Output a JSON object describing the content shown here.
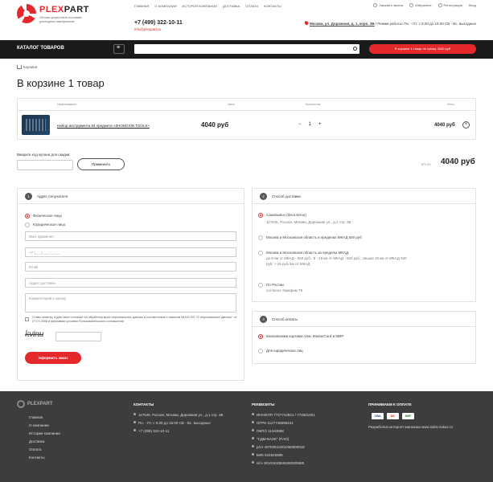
{
  "header": {
    "logo_name_a": "PLEX",
    "logo_name_b": "PART",
    "logo_sub": "Оптово-розничные поставки расходных материалов",
    "nav": [
      "Главная",
      "О компании",
      "История компании",
      "Доставка",
      "Оплата",
      "Контакты"
    ],
    "links": [
      "Заказать звонок",
      "Избранное",
      "Регистрация",
      "Вход"
    ],
    "phone": "+7 (499) 322-10-11",
    "email": "info@plexpart.ru",
    "address": "Москва, ул. Дорожная, д. 1, корп. 3Б",
    "hours": " / Режим работы: Пн. - Пт. с 9.00 до 18.00 СБ - Вс. выходные"
  },
  "bar": {
    "catalog": "Каталог товаров",
    "cart_button": "В корзине 1 товар на сумму 4040 руб"
  },
  "breadcrumb": "Корзина",
  "title": "В корзине 1 товар",
  "cart": {
    "headers": [
      "Наименование",
      "Цена",
      "Количество",
      "Итого"
    ],
    "item": {
      "name": "Набор инструмента 94 предмета «ZHONGXIN TOOLS»",
      "price": "4040 руб",
      "minus": "−",
      "qty": "1",
      "plus": "+",
      "total": "4040 руб",
      "remove": "×"
    }
  },
  "coupon": {
    "label": "Введите код купона для скидки:",
    "button": "Применить",
    "total_label": "Итого",
    "total_value": "4040 руб"
  },
  "recipient": {
    "num": "1",
    "title": "Адрес получателя",
    "types": [
      "Физическое лицо",
      "Юридическое лицо"
    ],
    "fields": [
      "Имя, фамилия",
      "+7 (___) ___-__-__",
      "Email",
      "Адрес доставки",
      "Комментарий к заказу"
    ],
    "agree": "Ставя отметку, я даю свое согласие на обработку моих персональных данных в соответствии с законом №152-ФЗ \"О персональных данных\" от 27.07.2006 и принимаю условия Пользовательского соглашения",
    "captcha": "kvinu",
    "order_button": "Оформить заказ"
  },
  "delivery": {
    "num": "2",
    "title": "Способ доставки",
    "options": [
      {
        "label": "Самовывоз (бесплатно)",
        "sub": "117545, Россия, Москва, Дорожная ул., д.1 стр. 3Б"
      },
      {
        "label": "Москва и Московская область в пределах МКАД 500 руб",
        "sub": ""
      },
      {
        "label": "Москва и Московская область за пределы МКАД:",
        "sub": "до 8 км от МКАД - 550 руб.; 9 - 15 км от МКАД - 650 руб.; свыше 15 км от МКАД 500 руб. + 15 руб./км от МКАД"
      },
      {
        "label": "По России",
        "sub": "согласно тарифам ТК"
      }
    ]
  },
  "payment": {
    "num": "3",
    "title": "Способ оплаты",
    "options": [
      "Банковскими картами Visa, MasterCard и МИР",
      "Для юридических лиц"
    ]
  },
  "footer": {
    "logo": "PLEXPART",
    "nav": [
      "Главная",
      "О компании",
      "История компании",
      "Доставка",
      "Оплата",
      "Контакты"
    ],
    "contacts_head": "Контакты",
    "contacts": [
      "117545, Россия, Москва, Дорожная ул., д.1 стр. 3Б",
      "Пн. - Пт. с 9.00 до 18.00 СБ - Вс. выходные",
      "+7 (499) 322-10-11"
    ],
    "req_head": "Реквизиты",
    "req": [
      "ИНН/КПП 7727744921 / 772601001",
      "ОГРН 1127746699441",
      "ОКПО 11343968",
      "\"СДМ-БАНК\" (ПАО)",
      "р/сч 40702810201060000018",
      "БИК 044525685",
      "к/сч 30101810845250000685"
    ],
    "pay_head": "Принимаем к оплате",
    "pay_logos": [
      "VISA",
      "MC",
      "МИР"
    ],
    "dev": "Разработка интернет-магазина www.sidra-zakaz.ru"
  }
}
